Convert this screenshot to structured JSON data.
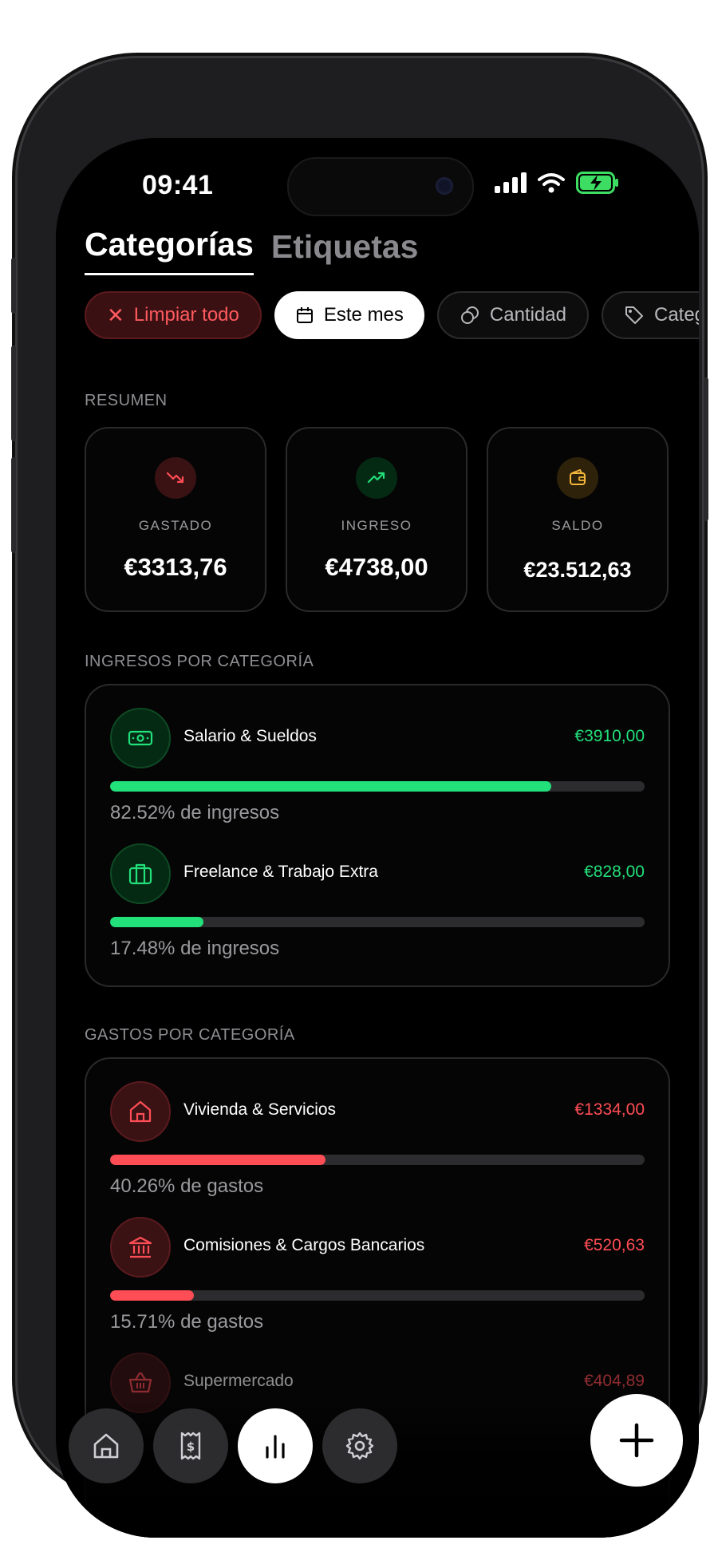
{
  "status_bar": {
    "time": "09:41"
  },
  "tabs": [
    {
      "label": "Categorías",
      "active": true
    },
    {
      "label": "Etiquetas",
      "active": false
    }
  ],
  "filters": [
    {
      "label": "Limpiar todo",
      "icon": "close-icon",
      "style": "clear"
    },
    {
      "label": "Este mes",
      "icon": "calendar-icon",
      "style": "active"
    },
    {
      "label": "Cantidad",
      "icon": "coins-icon",
      "style": "ghost"
    },
    {
      "label": "Categorías",
      "icon": "tag-icon",
      "style": "ghost"
    }
  ],
  "summary": {
    "label": "RESUMEN",
    "cards": [
      {
        "label": "GASTADO",
        "value": "€3313,76",
        "icon": "trending-down-icon",
        "color": "#ff4d55"
      },
      {
        "label": "INGRESO",
        "value": "€4738,00",
        "icon": "trending-up-icon",
        "color": "#22e07a"
      },
      {
        "label": "SALDO",
        "value": "€23.512,63",
        "icon": "wallet-icon",
        "color": "#f5b73b"
      }
    ]
  },
  "income": {
    "label": "INGRESOS POR CATEGORÍA",
    "items": [
      {
        "name": "Salario & Sueldos",
        "amount": "€3910,00",
        "percent_text": "82.52% de ingresos",
        "fraction": 0.8252,
        "icon": "banknote-icon"
      },
      {
        "name": "Freelance & Trabajo Extra",
        "amount": "€828,00",
        "percent_text": "17.48% de ingresos",
        "fraction": 0.1748,
        "icon": "briefcase-icon"
      }
    ]
  },
  "expenses": {
    "label": "GASTOS POR CATEGORÍA",
    "items": [
      {
        "name": "Vivienda & Servicios",
        "amount": "€1334,00",
        "percent_text": "40.26% de gastos",
        "fraction": 0.4026,
        "icon": "home-icon"
      },
      {
        "name": "Comisiones & Cargos Bancarios",
        "amount": "€520,63",
        "percent_text": "15.71% de gastos",
        "fraction": 0.1571,
        "icon": "bank-icon"
      },
      {
        "name": "Supermercado",
        "amount": "€404,89",
        "icon": "basket-icon"
      }
    ]
  },
  "colors": {
    "income": "#22e07a",
    "expense": "#ff4d55",
    "accent": "#ffffff"
  },
  "nav": [
    {
      "name": "home",
      "icon": "home-icon",
      "active": false
    },
    {
      "name": "transactions",
      "icon": "receipt-icon",
      "active": false
    },
    {
      "name": "stats",
      "icon": "bar-chart-icon",
      "active": true
    },
    {
      "name": "settings",
      "icon": "gear-icon",
      "active": false
    }
  ]
}
